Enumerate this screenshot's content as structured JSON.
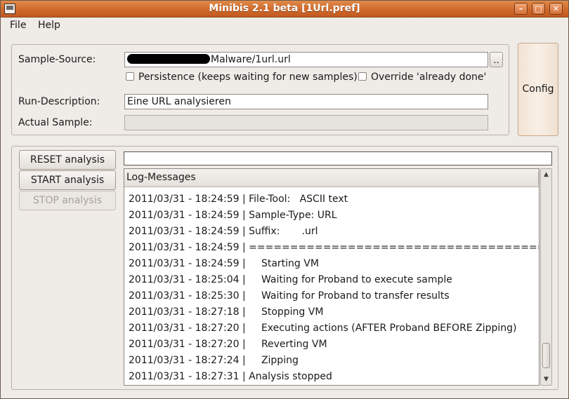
{
  "window": {
    "title": "Minibis 2.1 beta [1Url.pref]"
  },
  "menu": {
    "file": "File",
    "help": "Help"
  },
  "source": {
    "label": "Sample-Source:",
    "value": "Malware/1url.url",
    "browse_label": "..",
    "persistence_label": "Persistence (keeps waiting for new samples)",
    "override_label": "Override 'already done'"
  },
  "run": {
    "label": "Run-Description:",
    "value": "Eine URL analysieren"
  },
  "actual": {
    "label": "Actual Sample:",
    "value": ""
  },
  "config_label": "Config",
  "buttons": {
    "reset": "RESET analysis",
    "start": "START analysis",
    "stop": "STOP analysis"
  },
  "log": {
    "header": "Log-Messages",
    "rows": [
      "2011/03/31 - 18:24:59 | File-Tool:   ASCII text",
      "2011/03/31 - 18:24:59 | Sample-Type: URL",
      "2011/03/31 - 18:24:59 | Suffix:       .url",
      "2011/03/31 - 18:24:59 | ======================================",
      "2011/03/31 - 18:24:59 |     Starting VM",
      "2011/03/31 - 18:25:04 |     Waiting for Proband to execute sample",
      "2011/03/31 - 18:25:30 |     Waiting for Proband to transfer results",
      "2011/03/31 - 18:27:18 |     Stopping VM",
      "2011/03/31 - 18:27:20 |     Executing actions (AFTER Proband BEFORE Zipping)",
      "2011/03/31 - 18:27:20 |     Reverting VM",
      "2011/03/31 - 18:27:24 |     Zipping",
      "2011/03/31 - 18:27:31 | Analysis stopped"
    ]
  },
  "icons": {
    "app": "app-window-icon",
    "minimize": "minimize-icon",
    "maximize": "maximize-icon",
    "close": "close-icon",
    "scroll_up": "arrow-up-icon",
    "scroll_down": "arrow-down-icon"
  }
}
